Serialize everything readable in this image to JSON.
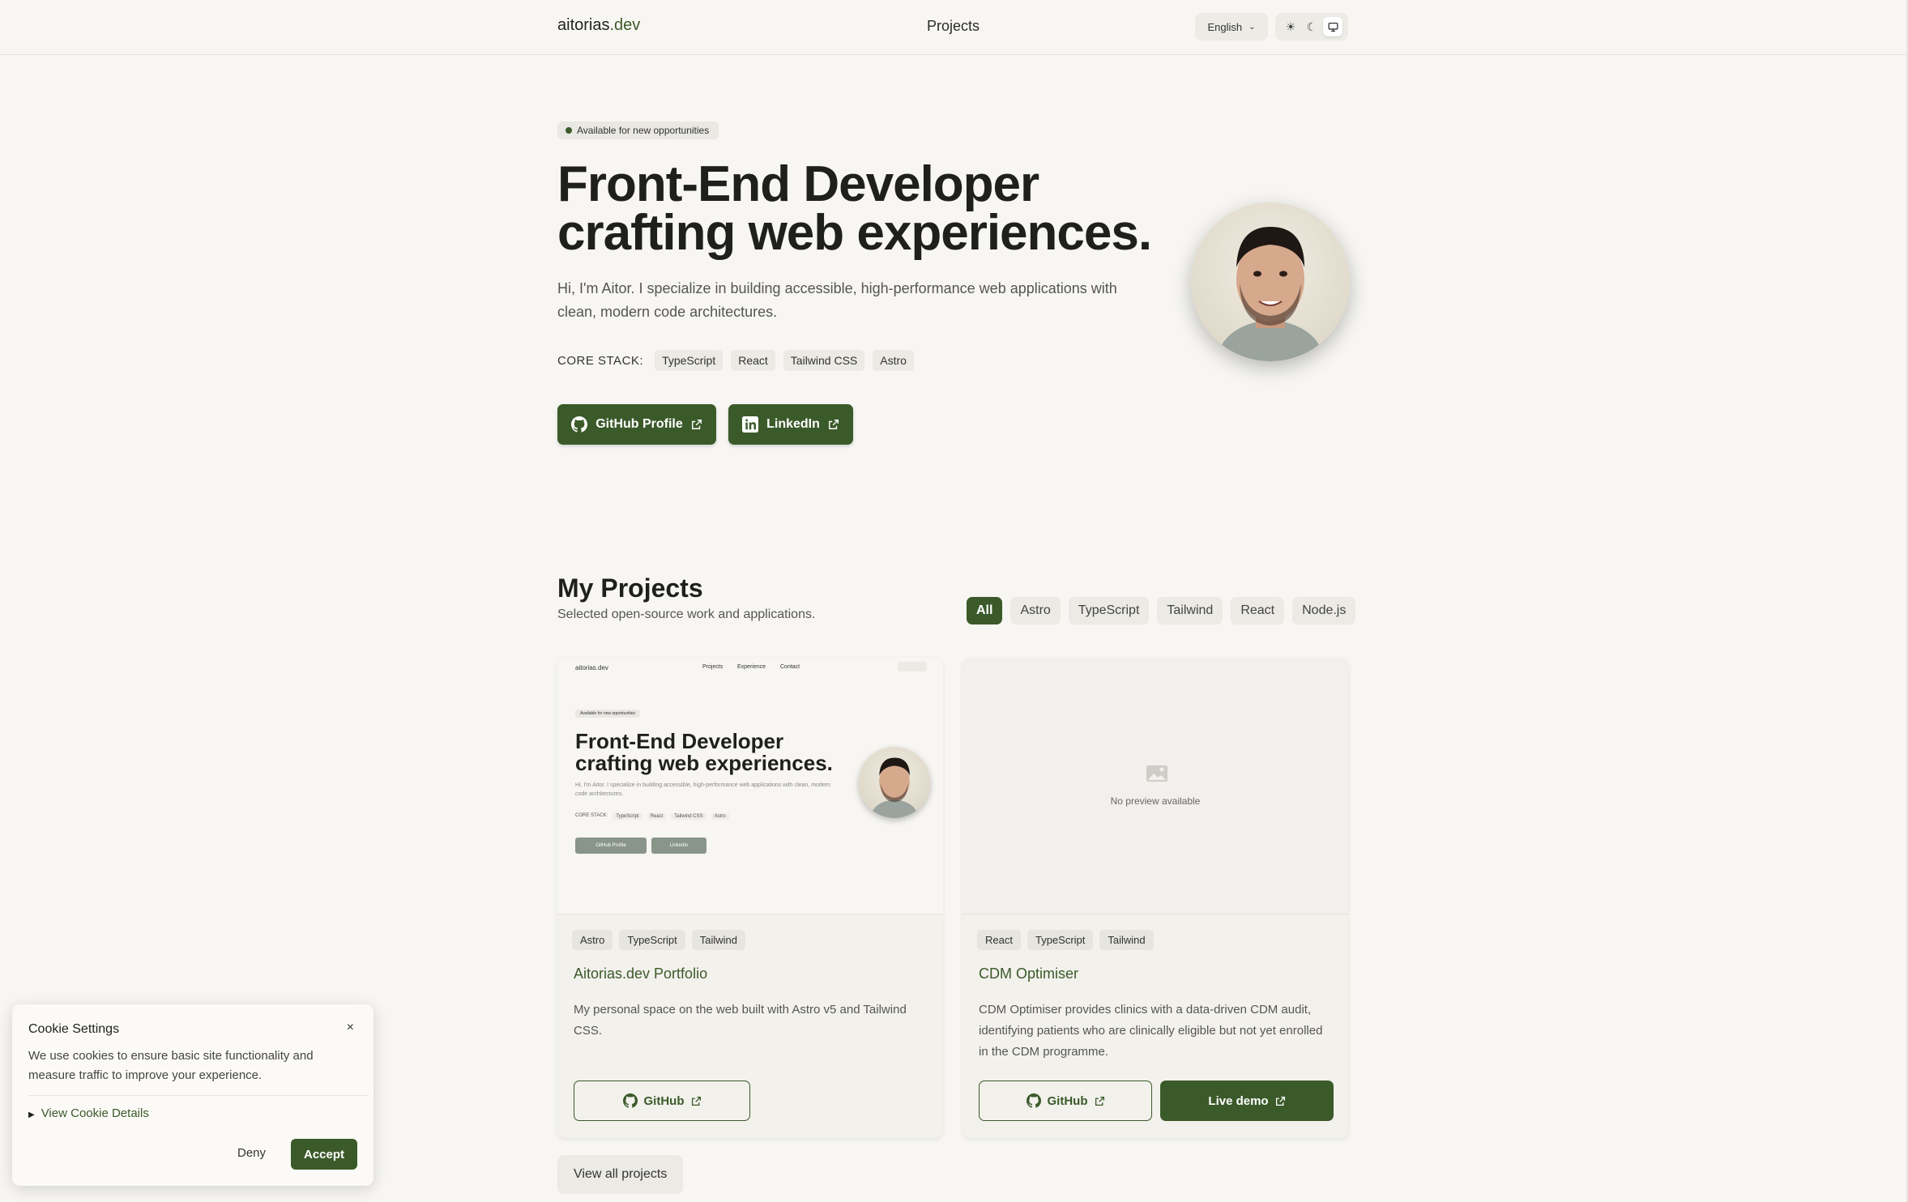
{
  "header": {
    "logo_main": "aitorias",
    "logo_tld": ".dev",
    "nav_projects": "Projects",
    "language": "English",
    "theme_icons": [
      "sun-icon",
      "moon-icon",
      "monitor-icon"
    ]
  },
  "hero": {
    "badge": "Available for new opportunities",
    "title_line1": "Front-End Developer",
    "title_line2": "crafting web experiences.",
    "description": "Hi, I'm Aitor. I specialize in building accessible, high-performance web applications with clean, modern code architectures.",
    "stack_label": "CORE STACK:",
    "stack": [
      "TypeScript",
      "React",
      "Tailwind CSS",
      "Astro"
    ],
    "github_button": "GitHub Profile",
    "linkedin_button": "LinkedIn"
  },
  "projects": {
    "title": "My Projects",
    "subtitle": "Selected open-source work and applications.",
    "filters": [
      "All",
      "Astro",
      "TypeScript",
      "Tailwind",
      "React",
      "Node.js"
    ],
    "active_filter": "All",
    "cards": [
      {
        "tags": [
          "Astro",
          "TypeScript",
          "Tailwind"
        ],
        "title": "Aitorias.dev Portfolio",
        "description": "My personal space on the web built with Astro v5 and Tailwind CSS.",
        "github": "GitHub"
      },
      {
        "tags": [
          "React",
          "TypeScript",
          "Tailwind"
        ],
        "title": "CDM Optimiser",
        "description": "CDM Optimiser provides clinics with a data-driven CDM audit, identifying patients who are clinically eligible but not yet enrolled in the CDM programme.",
        "github": "GitHub",
        "live": "Live demo",
        "no_preview": "No preview available"
      }
    ],
    "view_all": "View all projects"
  },
  "mini_preview": {
    "logo": "aitorias.dev",
    "nav": [
      "Projects",
      "Experience",
      "Contact"
    ],
    "badge": "Available for new opportunities",
    "title": "Front-End Developer crafting web experiences.",
    "desc": "Hi, I'm Aitor. I specialize in building accessible, high-performance web applications with clean, modern code architectures.",
    "stack_label": "CORE STACK:",
    "stack": [
      "TypeScript",
      "React",
      "Tailwind CSS",
      "Astro"
    ],
    "btn1": "GitHub Profile",
    "btn2": "LinkedIn"
  },
  "cookie": {
    "title": "Cookie Settings",
    "close": "×",
    "text": "We use cookies to ensure basic site functionality and measure traffic to improve your experience.",
    "details": "View Cookie Details",
    "deny": "Deny",
    "accept": "Accept"
  },
  "colors": {
    "accent": "#3b5a2a",
    "background": "#f7f6f2"
  }
}
